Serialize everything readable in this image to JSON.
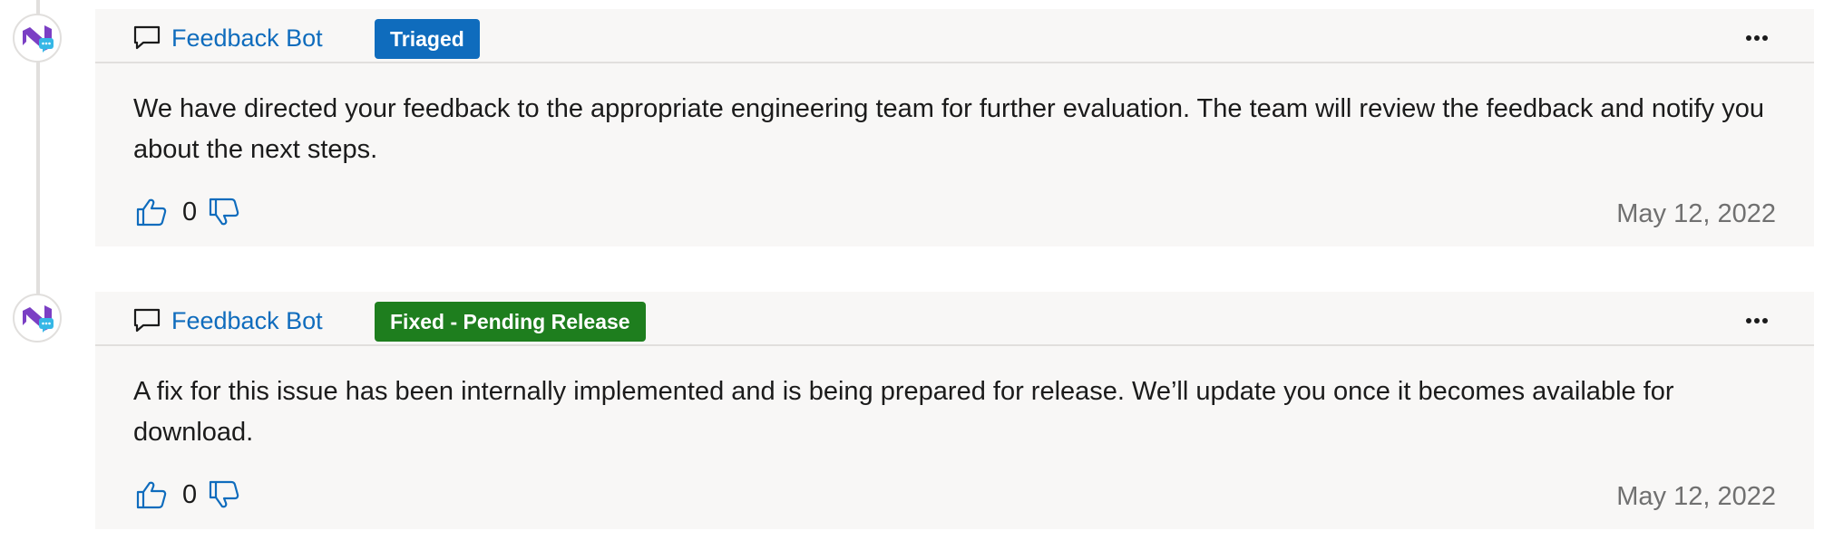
{
  "entries": [
    {
      "author": "Feedback Bot",
      "badge": "Triaged",
      "badge_color": "#0f6cbd",
      "message": "We have directed your feedback to the appropriate engineering team for further evaluation. The team will review the feedback and notify you about the next steps.",
      "vote_count": "0",
      "date": "May 12, 2022"
    },
    {
      "author": "Feedback Bot",
      "badge": "Fixed - Pending Release",
      "badge_color": "#1e7e1e",
      "message": "A fix for this issue has been internally implemented and is being prepared for release. We’ll update you once it becomes available for download.",
      "vote_count": "0",
      "date": "May 12, 2022"
    }
  ],
  "colors": {
    "link": "#0f6cbd",
    "card_background": "#f8f7f6",
    "divider": "#e1dfdd",
    "avatar_brand": "#7b3fc4",
    "avatar_chat": "#36b7e6"
  },
  "icons": {
    "avatar": "visual-studio-feedback-bot-icon",
    "comment": "comment-icon",
    "more": "more-options-icon",
    "upvote": "thumbs-up-icon",
    "downvote": "thumbs-down-icon"
  }
}
